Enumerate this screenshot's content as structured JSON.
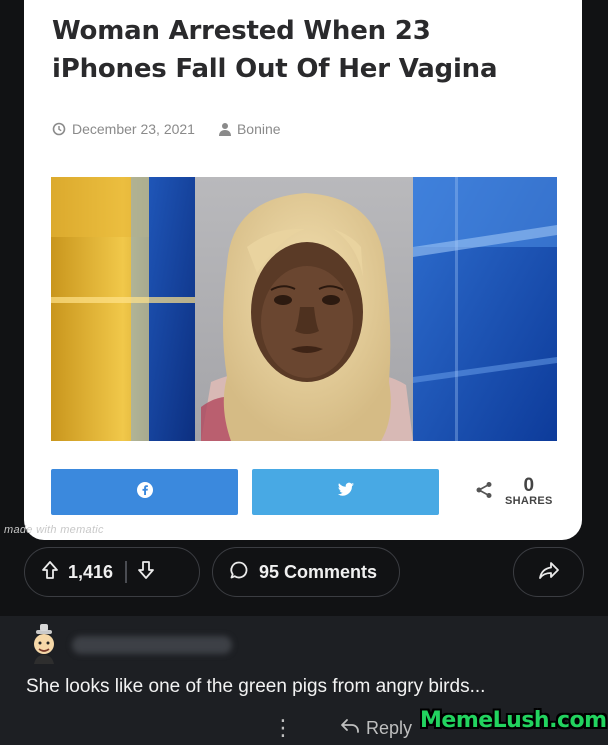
{
  "article": {
    "headline_line1": "Woman Arrested When 23",
    "headline_line2": "iPhones Fall Out Of Her Vagina",
    "date": "December 23, 2021",
    "author": "Bonine",
    "share_count": "0",
    "share_label": "SHARES"
  },
  "watermarks": {
    "maker": "made with mematic",
    "site": "MemeLush.com"
  },
  "post_actions": {
    "vote_count": "1,416",
    "comments_label": "95 Comments"
  },
  "comment": {
    "text": "She looks like one of the green pigs from angry birds...",
    "reply_label": "Reply"
  },
  "colors": {
    "facebook_button": "#3b89dd",
    "twitter_button": "#48a9e4",
    "watermark_green": "#22d35f"
  }
}
